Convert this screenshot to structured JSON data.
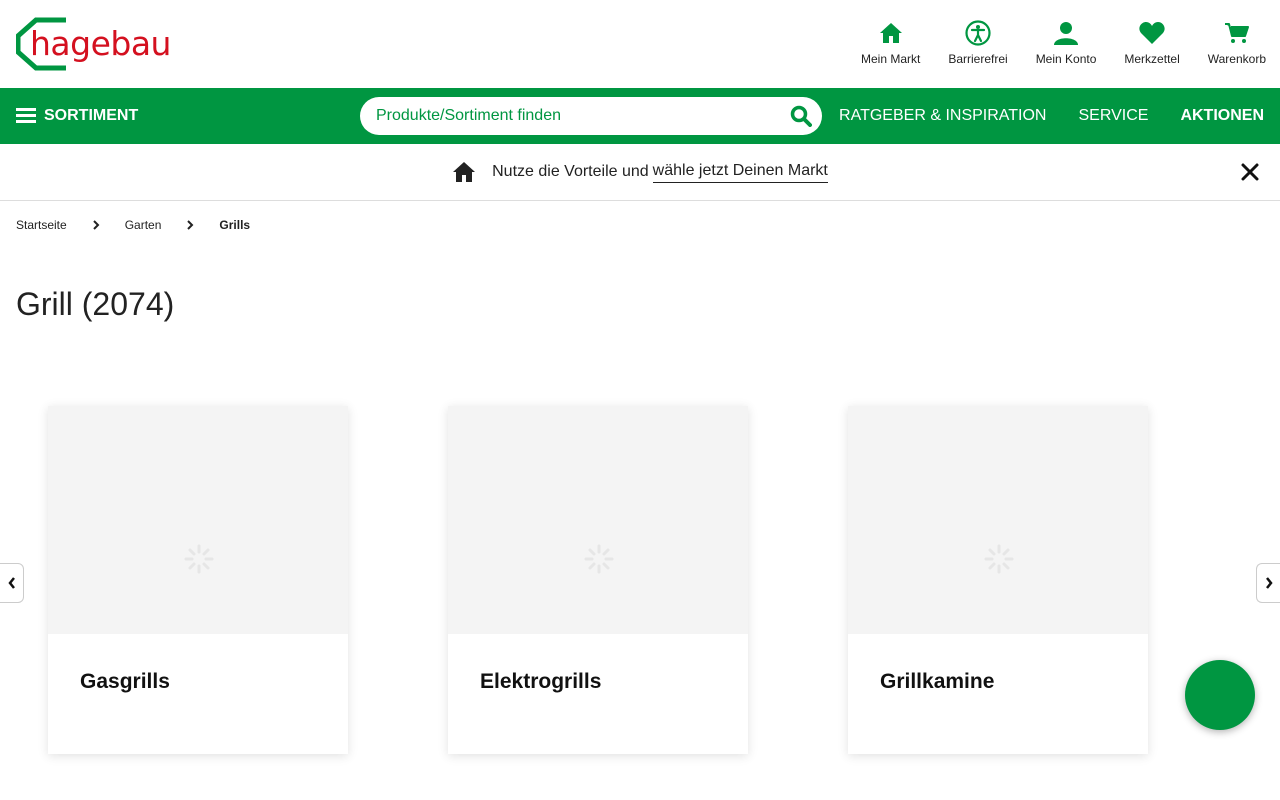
{
  "brand": {
    "name": "hagebau",
    "color_red": "#d4101f",
    "color_green": "#009641"
  },
  "top_icons": [
    {
      "label": "Mein Markt",
      "icon": "home-icon"
    },
    {
      "label": "Barrierefrei",
      "icon": "accessibility-icon"
    },
    {
      "label": "Mein Konto",
      "icon": "user-icon"
    },
    {
      "label": "Merkzettel",
      "icon": "heart-icon"
    },
    {
      "label": "Warenkorb",
      "icon": "cart-icon"
    }
  ],
  "navbar": {
    "sortiment_label": "SORTIMENT",
    "search_placeholder": "Produkte/Sortiment finden",
    "links": [
      "RATGEBER & INSPIRATION",
      "SERVICE",
      "AKTIONEN"
    ]
  },
  "notice": {
    "text": "Nutze die Vorteile und",
    "link_text": "wähle jetzt Deinen Markt"
  },
  "breadcrumb": [
    "Startseite",
    "Garten",
    "Grills"
  ],
  "page_title": "Grill (2074)",
  "categories": [
    {
      "title": "Gasgrills"
    },
    {
      "title": "Elektrogrills"
    },
    {
      "title": "Grillkamine"
    }
  ]
}
